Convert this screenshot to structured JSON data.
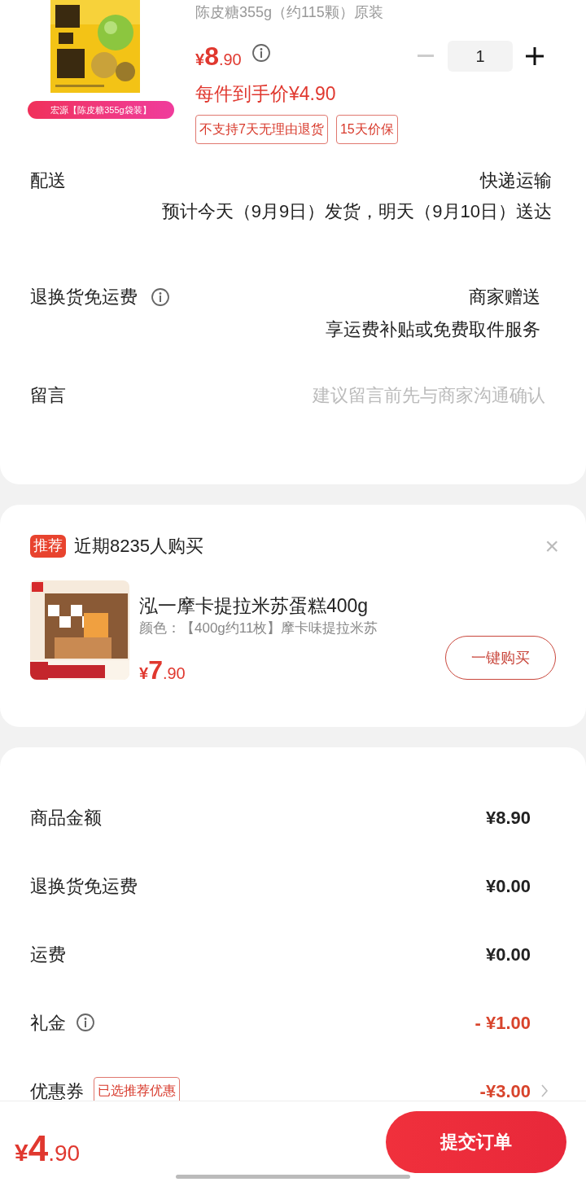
{
  "product": {
    "spec": "陈皮糖355g（约115颗）原装",
    "image_label": "宏源【陈皮糖355g袋装】",
    "price_symbol": "¥",
    "price_int": "8",
    "price_dec": ".90",
    "final_price": "每件到手价¥4.90",
    "quantity": "1",
    "minus_disabled": true,
    "tags": [
      "不支持7天无理由退货",
      "15天价保"
    ]
  },
  "info_rows": [
    {
      "kind": "delivery",
      "label": "配送",
      "value": "快递运输",
      "detail": "预计今天（9月9日）发货，明天（9月10日）送达"
    },
    {
      "kind": "return",
      "label": "退换货免运费",
      "info": true,
      "value": "商家赠送",
      "detail": "享运费补贴或免费取件服务"
    },
    {
      "kind": "message",
      "label": "留言",
      "placeholder": "建议留言前先与商家沟通确认"
    }
  ],
  "recommend": {
    "badge": "推荐",
    "title": "近期8235人购买",
    "close": "×",
    "name": "泓一摩卡提拉米苏蛋糕400g",
    "spec": "颜色：【400g约11枚】摩卡味提拉米苏",
    "price_symbol": "¥",
    "price_int": "7",
    "price_dec": ".90",
    "button": "一键购买"
  },
  "fees": [
    {
      "label": "商品金额",
      "value": "¥8.90",
      "discount": false
    },
    {
      "label": "退换货免运费",
      "value": "¥0.00",
      "discount": false
    },
    {
      "label": "运费",
      "value": "¥0.00",
      "discount": false
    },
    {
      "label": "礼金",
      "info": true,
      "value": "- ¥1.00",
      "discount": true
    },
    {
      "label": "优惠券",
      "tag": "已选推荐优惠",
      "value": "-¥3.00",
      "discount": true,
      "chevron": true
    }
  ],
  "footer": {
    "price_symbol": "¥",
    "price_int": "4",
    "price_dec": ".90",
    "submit": "提交订单"
  }
}
